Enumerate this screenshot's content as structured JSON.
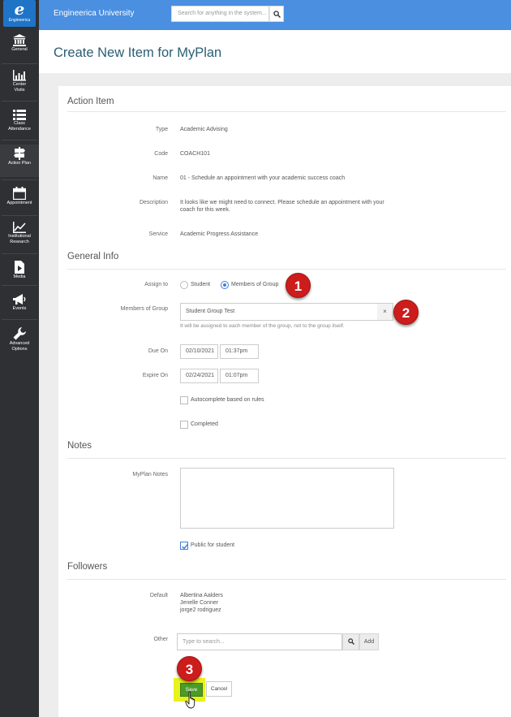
{
  "sidebar": {
    "logo_letter": "e",
    "logo_text": "Engineerica",
    "items": [
      {
        "icon": "bank-icon",
        "label": "General"
      },
      {
        "icon": "bar-chart-icon",
        "label": "Center Visits"
      },
      {
        "icon": "list-icon",
        "label": "Class Attendance"
      },
      {
        "icon": "signpost-icon",
        "label": "Action Plan"
      },
      {
        "icon": "calendar-icon",
        "label": "Appointment"
      },
      {
        "icon": "line-chart-icon",
        "label": "Institutional Research"
      },
      {
        "icon": "media-icon",
        "label": "Media"
      },
      {
        "icon": "megaphone-icon",
        "label": "Events"
      },
      {
        "icon": "wrench-icon",
        "label": "Advanced Options"
      }
    ]
  },
  "topbar": {
    "app_name": "Engineerica University",
    "search_placeholder": "Search for anything in the system..."
  },
  "page": {
    "title": "Create New Item for MyPlan"
  },
  "action_item": {
    "title": "Action Item",
    "fields": [
      {
        "label": "Type",
        "value": "Academic Advising"
      },
      {
        "label": "Code",
        "value": "COACH101"
      },
      {
        "label": "Name",
        "value": "01 - Schedule an appointment with your academic success coach"
      },
      {
        "label": "Description",
        "value_line1": "It looks like we might need to connect. Please schedule an appointment with your",
        "value_line2": "coach for this week."
      },
      {
        "label": "Service",
        "value": "Academic Progress Assistance"
      }
    ]
  },
  "general_info": {
    "title": "General Info",
    "assign_to_label": "Assign to",
    "option_student": "Student",
    "option_members": "Members of Group",
    "selected": "Members of Group",
    "members_label": "Members of Group",
    "members_value": "Student Group Test",
    "clear_symbol": "×",
    "members_help": "It will be assigned to each member of the group, not to the group itself.",
    "due_label": "Due On",
    "due_date": "02/10/2021",
    "due_time": "01:37pm",
    "expire_label": "Expire On",
    "expire_date": "02/24/2021",
    "expire_time": "01:07pm",
    "autocomplete_label": "Autocomplete based on rules",
    "autocomplete_checked": false,
    "completed_label": "Completed",
    "completed_checked": false
  },
  "notes": {
    "title": "Notes",
    "myplan_notes_label": "MyPlan Notes",
    "myplan_notes_value": "",
    "public_label": "Public for student",
    "public_checked": true
  },
  "followers": {
    "title": "Followers",
    "default_label": "Default",
    "default_names": [
      "Albertina Aalders",
      "Jenelle Conner",
      "jorge2 rodriguez"
    ],
    "other_label": "Other",
    "other_placeholder": "Type to search...",
    "add_label": "Add"
  },
  "actions": {
    "save_label": "Save",
    "cancel_label": "Cancel"
  },
  "callouts": [
    "1",
    "2",
    "3"
  ],
  "colors": {
    "sidebar_bg": "#2f3033",
    "topbar_bg": "#4a8fe0",
    "title_color": "#2a5e74",
    "save_green": "#4b9b27",
    "callout_red": "#cc1c1c",
    "highlight_yellow": "#e9f21c"
  }
}
